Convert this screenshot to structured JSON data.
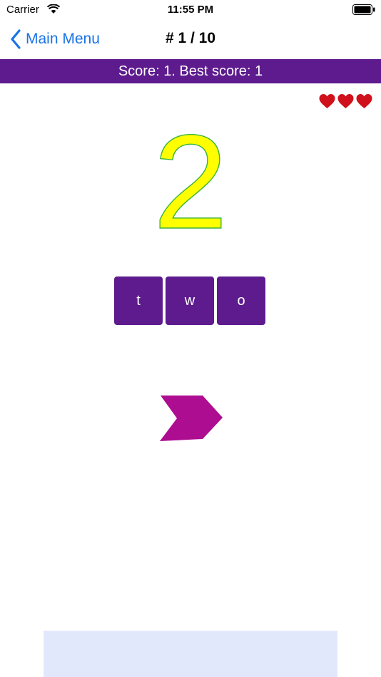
{
  "status_bar": {
    "carrier": "Carrier",
    "time": "11:55 PM"
  },
  "nav": {
    "back_label": "Main Menu",
    "title": "# 1 / 10"
  },
  "score": {
    "text": "Score: 1. Best score: 1"
  },
  "lives": {
    "count": 3,
    "icon": "heart-icon",
    "color": "#d0101a"
  },
  "question": {
    "number_text": "2",
    "fill_color": "#ffff00",
    "stroke_color": "#3bb33b"
  },
  "answer": {
    "letters": [
      "t",
      "w",
      "o"
    ]
  },
  "next": {
    "icon": "arrow-right-icon",
    "color": "#ad0d90"
  },
  "colors": {
    "accent": "#5d1b8e",
    "link": "#1a73e8",
    "ad_background": "#e2e8fc"
  }
}
